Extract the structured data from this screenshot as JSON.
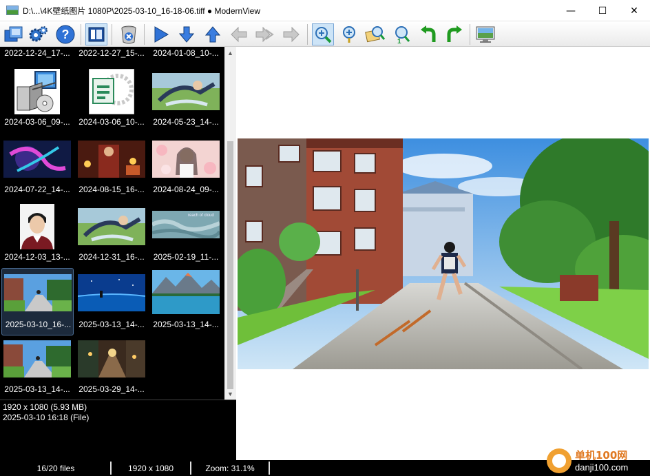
{
  "window": {
    "title": "D:\\...\\4K壁纸图片 1080P\\2025-03-10_16-18-06.tiff ● ModernView",
    "minimize": "—",
    "maximize": "☐",
    "close": "✕"
  },
  "toolbar": {
    "buttons": [
      "browse-folders",
      "settings",
      "help",
      "toggle-panel",
      "delete",
      "play-slideshow",
      "next",
      "previous",
      "back",
      "forward",
      "forward-alt",
      "zoom-fit",
      "zoom-in",
      "zoom-options",
      "zoom-out",
      "rotate-left",
      "rotate-right",
      "fullscreen"
    ]
  },
  "thumbnails": [
    {
      "caption": "2022-12-24_17-..."
    },
    {
      "caption": "2022-12-27_15-..."
    },
    {
      "caption": "2024-01-08_10-..."
    },
    {
      "caption": "2024-03-06_09-..."
    },
    {
      "caption": "2024-03-06_10-..."
    },
    {
      "caption": "2024-05-23_14-..."
    },
    {
      "caption": "2024-07-22_14-..."
    },
    {
      "caption": "2024-08-15_16-..."
    },
    {
      "caption": "2024-08-24_09-..."
    },
    {
      "caption": "2024-12-03_13-..."
    },
    {
      "caption": "2024-12-31_16-..."
    },
    {
      "caption": "2025-02-19_11-..."
    },
    {
      "caption": "2025-03-10_16-..."
    },
    {
      "caption": "2025-03-13_14-..."
    },
    {
      "caption": "2025-03-13_14-..."
    },
    {
      "caption": "2025-03-13_14-..."
    },
    {
      "caption": "2025-03-29_14-..."
    }
  ],
  "thumb_art": {
    "watermark_text": "reach of cloud"
  },
  "info": {
    "dimensions": "1920 x 1080 (5.93 MB)",
    "date": "2025-03-10 16:18 (File)"
  },
  "status": {
    "files": "16/20 files",
    "resolution": "1920 x 1080",
    "zoom": "Zoom: 31.1%"
  },
  "watermark": {
    "line1": "单机100网",
    "line2": "danji100.com"
  },
  "colors": {
    "accent_blue": "#2a6fd6",
    "green_arrow": "#1e9a1e",
    "selection_border": "#4d6f97"
  }
}
